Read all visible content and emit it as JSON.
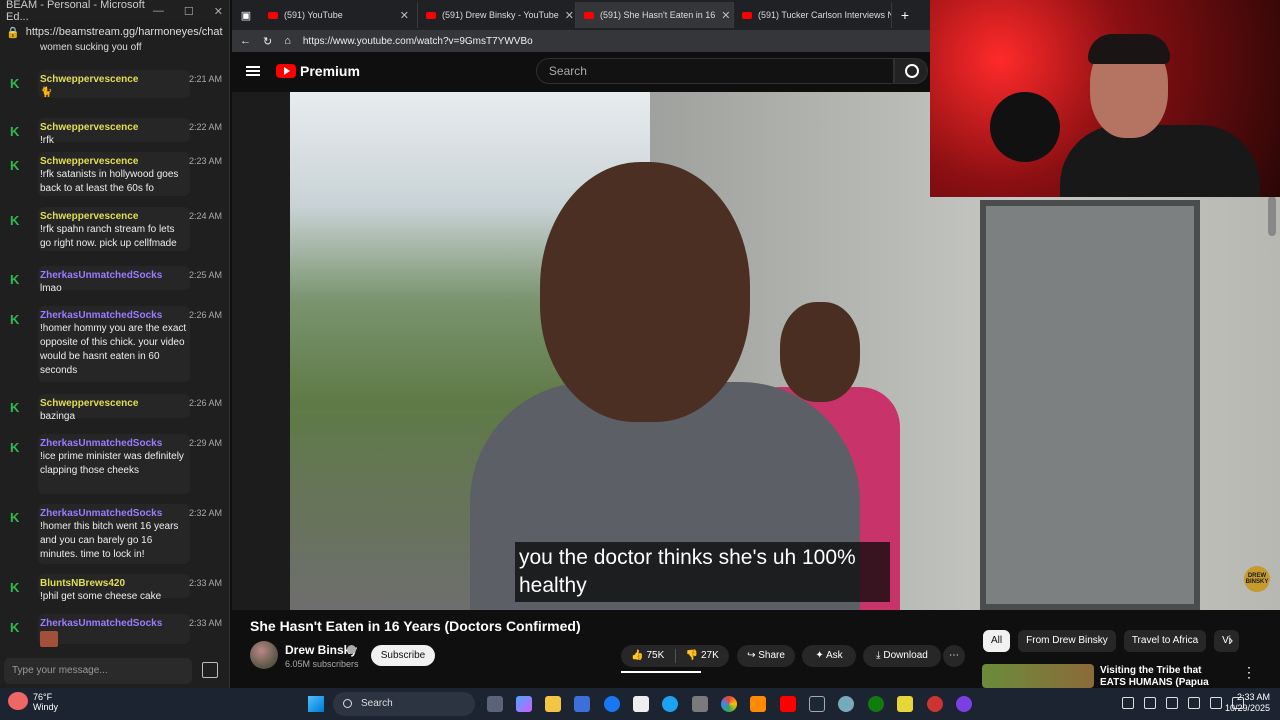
{
  "chat_window": {
    "title": "BEAM - Personal - Microsoft Ed...",
    "url": "https://beamstream.gg/harmoneyes/chat",
    "partial_top_text": "women sucking you off",
    "messages": [
      {
        "user": "Schweppervescence",
        "color": "#e3df52",
        "text": "🐈",
        "time": "2:21 AM"
      },
      {
        "user": "Schweppervescence",
        "color": "#e3df52",
        "text": "!rfk",
        "time": "2:22 AM"
      },
      {
        "user": "Schweppervescence",
        "color": "#e3df52",
        "text": "!rfk satanists in hollywood goes back to at least the 60s fo",
        "time": "2:23 AM"
      },
      {
        "user": "Schweppervescence",
        "color": "#e3df52",
        "text": "!rfk spahn ranch stream fo lets go right now. pick up cellfmade",
        "time": "2:24 AM"
      },
      {
        "user": "ZherkasUnmatchedSocks",
        "color": "#9a7cff",
        "text": "lmao",
        "time": "2:25 AM"
      },
      {
        "user": "ZherkasUnmatchedSocks",
        "color": "#9a7cff",
        "text": "!homer hommy you are the exact opposite of this chick. your video would be hasnt eaten in 60 seconds",
        "time": "2:26 AM"
      },
      {
        "user": "Schweppervescence",
        "color": "#e3df52",
        "text": "bazinga",
        "time": "2:26 AM"
      },
      {
        "user": "ZherkasUnmatchedSocks",
        "color": "#9a7cff",
        "text": "!ice prime minister was definitely clapping those cheeks",
        "time": "2:29 AM"
      },
      {
        "user": "ZherkasUnmatchedSocks",
        "color": "#9a7cff",
        "text": "!homer this bitch went 16 years and you can barely go 16 minutes. time to lock in!",
        "time": "2:32 AM"
      },
      {
        "user": "BluntsNBrews420",
        "color": "#e3df52",
        "text": "!phil get some cheese cake",
        "time": "2:33 AM"
      },
      {
        "user": "ZherkasUnmatchedSocks",
        "color": "#9a7cff",
        "text": "",
        "time": "2:33 AM"
      }
    ],
    "input_placeholder": "Type your message..."
  },
  "browser": {
    "tabs": [
      {
        "label": "(591) YouTube",
        "active": false
      },
      {
        "label": "(591) Drew Binsky - YouTube",
        "active": false
      },
      {
        "label": "(591) She Hasn't Eaten in 16",
        "active": true
      },
      {
        "label": "(591) Tucker Carlson Interviews N",
        "active": false
      }
    ],
    "url": "https://www.youtube.com/watch?v=9GmsT7YWVBo"
  },
  "youtube": {
    "logo": "Premium",
    "search_placeholder": "Search",
    "subtitle": "you the doctor thinks she's uh 100% healthy",
    "watermark": "DREW BINSKY",
    "video_title": "She Hasn't Eaten in 16 Years (Doctors Confirmed)",
    "channel": "Drew Binsky",
    "subscribers": "6.05M subscribers",
    "subscribe_label": "Subscribe",
    "likes": "75K",
    "dislikes": "27K",
    "share_label": "Share",
    "ask_label": "Ask",
    "download_label": "Download",
    "chips": [
      "All",
      "From Drew Binsky",
      "Travel to Africa",
      "Vi"
    ],
    "recommended_title": "Visiting the Tribe that EATS HUMANS (Papua Island)"
  },
  "taskbar": {
    "temp": "76°F",
    "condition": "Windy",
    "search_label": "Search",
    "time": "2:33 AM",
    "date": "10/29/2025"
  }
}
